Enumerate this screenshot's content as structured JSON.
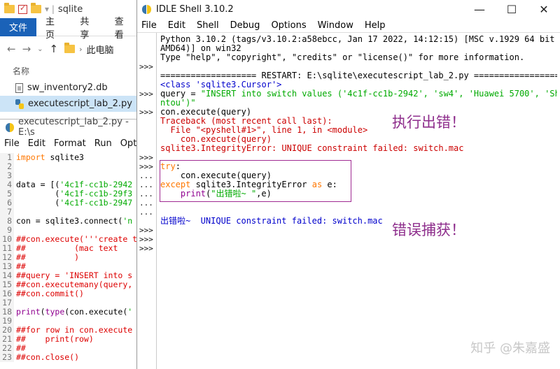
{
  "explorer": {
    "title": "sqlite",
    "ribbon": {
      "file_tab": "文件",
      "tabs": [
        "主页",
        "共享",
        "查看"
      ]
    },
    "address": "此电脑",
    "column_header": "名称",
    "files": [
      {
        "name": "sw_inventory2.db",
        "icon": "database-file-icon",
        "selected": false
      },
      {
        "name": "executescript_lab_2.py",
        "icon": "python-file-icon",
        "selected": true
      }
    ]
  },
  "editor": {
    "title": "executescript_lab_2.py - E:\\s",
    "menu": [
      "File",
      "Edit",
      "Format",
      "Run",
      "Opti"
    ],
    "lines": [
      {
        "n": "1",
        "parts": [
          {
            "t": "import",
            "c": "kw"
          },
          {
            "t": " sqlite3",
            "c": ""
          }
        ]
      },
      {
        "n": "2",
        "parts": []
      },
      {
        "n": "3",
        "parts": []
      },
      {
        "n": "4",
        "parts": [
          {
            "t": "data = [(",
            "c": ""
          },
          {
            "t": "'4c1f-cc1b-2942",
            "c": "str"
          }
        ]
      },
      {
        "n": "5",
        "parts": [
          {
            "t": "        (",
            "c": ""
          },
          {
            "t": "'4c1f-cc1b-29f3",
            "c": "str"
          }
        ]
      },
      {
        "n": "6",
        "parts": [
          {
            "t": "        (",
            "c": ""
          },
          {
            "t": "'4c1f-cc1b-2947",
            "c": "str"
          }
        ]
      },
      {
        "n": "7",
        "parts": []
      },
      {
        "n": "8",
        "parts": [
          {
            "t": "con = sqlite3.connect(",
            "c": ""
          },
          {
            "t": "'n",
            "c": "str"
          }
        ]
      },
      {
        "n": "9",
        "parts": []
      },
      {
        "n": "10",
        "parts": [
          {
            "t": "##con.execute('''create t",
            "c": "cmt"
          }
        ]
      },
      {
        "n": "11",
        "parts": [
          {
            "t": "##          (mac text ",
            "c": "cmt"
          }
        ]
      },
      {
        "n": "12",
        "parts": [
          {
            "t": "##          )",
            "c": "cmt"
          }
        ]
      },
      {
        "n": "13",
        "parts": [
          {
            "t": "##",
            "c": "cmt"
          }
        ]
      },
      {
        "n": "14",
        "parts": [
          {
            "t": "##query = 'INSERT into s",
            "c": "cmt"
          }
        ]
      },
      {
        "n": "15",
        "parts": [
          {
            "t": "##con.executemany(query,",
            "c": "cmt"
          }
        ]
      },
      {
        "n": "16",
        "parts": [
          {
            "t": "##con.commit()",
            "c": "cmt"
          }
        ]
      },
      {
        "n": "17",
        "parts": []
      },
      {
        "n": "18",
        "parts": [
          {
            "t": "print",
            "c": "bi"
          },
          {
            "t": "(",
            "c": ""
          },
          {
            "t": "type",
            "c": "bi"
          },
          {
            "t": "(con.execute(",
            "c": ""
          },
          {
            "t": "'",
            "c": "str"
          }
        ]
      },
      {
        "n": "19",
        "parts": []
      },
      {
        "n": "20",
        "parts": [
          {
            "t": "##for row in con.execute",
            "c": "cmt"
          }
        ]
      },
      {
        "n": "21",
        "parts": [
          {
            "t": "##    print(row)",
            "c": "cmt"
          }
        ]
      },
      {
        "n": "22",
        "parts": [
          {
            "t": "##",
            "c": "cmt"
          }
        ]
      },
      {
        "n": "23",
        "parts": [
          {
            "t": "##con.close()",
            "c": "cmt"
          }
        ]
      }
    ]
  },
  "shell": {
    "title": "IDLE Shell 3.10.2",
    "menu": [
      "File",
      "Edit",
      "Shell",
      "Debug",
      "Options",
      "Window",
      "Help"
    ],
    "prompts": [
      {
        "t": ">>>",
        "row": 3
      },
      {
        "t": ">>>",
        "row": 6
      },
      {
        "t": ">>>",
        "row": 8
      },
      {
        "t": ">>>",
        "row": 13
      },
      {
        "t": ">>>",
        "row": 14
      },
      {
        "t": "...",
        "row": 15
      },
      {
        "t": "...",
        "row": 16
      },
      {
        "t": "...",
        "row": 17
      },
      {
        "t": "...",
        "row": 18
      },
      {
        "t": "...",
        "row": 19
      },
      {
        "t": ">>>",
        "row": 21
      },
      {
        "t": ">>>",
        "row": 22
      },
      {
        "t": ">>>",
        "row": 23
      }
    ],
    "output": [
      {
        "parts": [
          {
            "t": "Python 3.10.2 (tags/v3.10.2:a58ebcc, Jan 17 2022, 14:12:15) [MSC v.1929 64 bit (",
            "c": "plain"
          }
        ]
      },
      {
        "parts": [
          {
            "t": "AMD64)] on win32",
            "c": "plain"
          }
        ]
      },
      {
        "parts": [
          {
            "t": "Type \"help\", \"copyright\", \"credits\" or \"license()\" for more information.",
            "c": "plain"
          }
        ]
      },
      {
        "parts": []
      },
      {
        "parts": [
          {
            "t": "=================== RESTART: E:\\sqlite\\executescript_lab_2.py ===================",
            "c": "plain"
          }
        ]
      },
      {
        "parts": [
          {
            "t": "<class 'sqlite3.Cursor'>",
            "c": "out"
          }
        ]
      },
      {
        "parts": [
          {
            "t": "query = ",
            "c": "in"
          },
          {
            "t": "\"INSERT into switch values ('4c1f-cc1b-2942', 'sw4', 'Huawei 5700', 'Sha",
            "c": "str"
          }
        ]
      },
      {
        "parts": [
          {
            "t": "ntou')\"",
            "c": "str"
          }
        ]
      },
      {
        "parts": [
          {
            "t": "con.execute(query)",
            "c": "in"
          }
        ]
      },
      {
        "parts": [
          {
            "t": "Traceback (most recent call last):",
            "c": "err"
          }
        ]
      },
      {
        "parts": [
          {
            "t": "  File \"<pyshell#1>\", line 1, in <module>",
            "c": "err"
          }
        ]
      },
      {
        "parts": [
          {
            "t": "    con.execute(query)",
            "c": "err"
          }
        ]
      },
      {
        "parts": [
          {
            "t": "sqlite3.IntegrityError: UNIQUE constraint failed: switch.mac",
            "c": "err"
          }
        ]
      },
      {
        "parts": []
      },
      {
        "parts": [
          {
            "t": "try",
            "c": "kw"
          },
          {
            "t": ":",
            "c": "in"
          }
        ]
      },
      {
        "parts": [
          {
            "t": "    con.execute(query)",
            "c": "in"
          }
        ]
      },
      {
        "parts": [
          {
            "t": "except",
            "c": "kw"
          },
          {
            "t": " sqlite3.IntegrityError ",
            "c": "in"
          },
          {
            "t": "as",
            "c": "kw"
          },
          {
            "t": " e:",
            "c": "in"
          }
        ]
      },
      {
        "parts": [
          {
            "t": "    ",
            "c": "in"
          },
          {
            "t": "print",
            "c": "bi"
          },
          {
            "t": "(",
            "c": "in"
          },
          {
            "t": "\"出错啦~ \"",
            "c": "str"
          },
          {
            "t": ",e)",
            "c": "in"
          }
        ]
      },
      {
        "parts": []
      },
      {
        "parts": []
      },
      {
        "parts": [
          {
            "t": "出错啦~  UNIQUE constraint failed: switch.mac",
            "c": "out"
          }
        ]
      }
    ],
    "annotations": {
      "error": "执行出错！",
      "caught": "错误捕获！"
    },
    "watermark": "知乎 @朱嘉盛"
  },
  "colors": {
    "explorer_tab": "#1a62b8",
    "annotation": "#8e2e8c",
    "highlight_box": "#a02b93"
  }
}
